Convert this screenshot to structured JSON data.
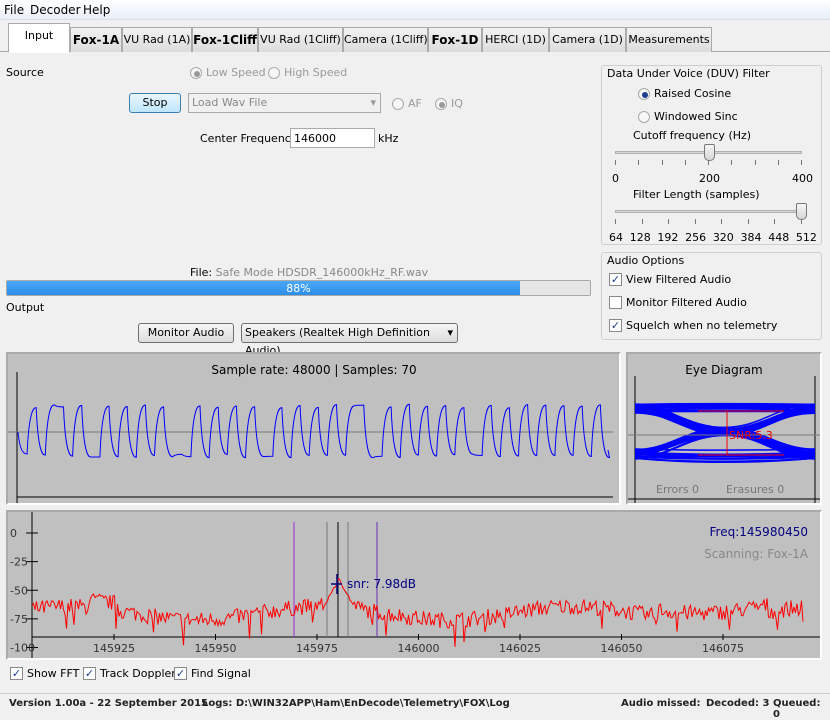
{
  "menu": [
    "File",
    "Decoder",
    "Help"
  ],
  "tabs": [
    {
      "label": "Input",
      "bold": false
    },
    {
      "label": "Fox-1A",
      "bold": true
    },
    {
      "label": "VU Rad (1A)",
      "bold": false
    },
    {
      "label": "Fox-1Cliff",
      "bold": true
    },
    {
      "label": "VU Rad (1Cliff)",
      "bold": false
    },
    {
      "label": "Camera (1Cliff)",
      "bold": false
    },
    {
      "label": "Fox-1D",
      "bold": true
    },
    {
      "label": "HERCI (1D)",
      "bold": false
    },
    {
      "label": "Camera (1D)",
      "bold": false
    },
    {
      "label": "Measurements",
      "bold": false
    }
  ],
  "source": {
    "label": "Source",
    "low_speed": "Low Speed",
    "high_speed": "High Speed",
    "speed_selected": "Low Speed",
    "stop_button": "Stop",
    "source_select": "Load Wav File",
    "af": "AF",
    "iq": "IQ",
    "mode_selected": "IQ",
    "center_freq_label": "Center Frequency",
    "center_freq_value": "146000",
    "center_freq_unit": "kHz"
  },
  "duv": {
    "title": "Data Under Voice (DUV) Filter",
    "raised_cosine": "Raised Cosine",
    "windowed_sinc": "Windowed Sinc",
    "selected": "Raised Cosine",
    "cutoff_label": "Cutoff frequency (Hz)",
    "cutoff_ticks": [
      "0",
      "200",
      "400"
    ],
    "cutoff_value": 200,
    "length_label": "Filter Length (samples)",
    "length_ticks": [
      "64",
      "128",
      "192",
      "256",
      "320",
      "384",
      "448",
      "512"
    ],
    "length_value": 512
  },
  "audio_options": {
    "title": "Audio Options",
    "view_filtered": "View Filtered Audio",
    "view_filtered_checked": true,
    "monitor_filtered": "Monitor Filtered Audio",
    "monitor_filtered_checked": false,
    "squelch": "Squelch when no telemetry",
    "squelch_checked": true
  },
  "file": {
    "label": "File:",
    "name": "Safe Mode HDSDR_146000kHz_RF.wav",
    "progress_text": "88%",
    "progress": 88
  },
  "output": {
    "label": "Output",
    "monitor_button": "Monitor Audio",
    "device_select": "Speakers (Realtek High Definition Audio)"
  },
  "wave": {
    "title": "Sample rate: 48000 | Samples: 70",
    "color": "#0000ff"
  },
  "eye": {
    "title": "Eye Diagram",
    "snr": "SNR:5.3",
    "errors": "Errors  0",
    "erasures": "Erasures  0",
    "color": "#0000ff"
  },
  "fft": {
    "freq": "Freq:145980450",
    "scanning": "Scanning: Fox-1A",
    "snr": "snr: 7.98dB",
    "y_ticks": [
      "0",
      "-25",
      "-50",
      "-75",
      "-100"
    ],
    "x_ticks": [
      "145925",
      "145950",
      "145975",
      "146000",
      "146025",
      "146050",
      "146075"
    ],
    "color": "#ff0000"
  },
  "fft_options": {
    "show_fft": "Show FFT",
    "track_doppler": "Track Doppler",
    "find_signal": "Find Signal",
    "show_fft_checked": true,
    "track_doppler_checked": true,
    "find_signal_checked": true
  },
  "status": {
    "version": "Version 1.00a - 22 September 2015",
    "logs": "Logs: D:\\WIN32APP\\Ham\\EnDecode\\Telemetry\\FOX\\Log",
    "audio_missed": "Audio missed:",
    "decoded": "Decoded: 3",
    "queued": "Queued: 0"
  }
}
